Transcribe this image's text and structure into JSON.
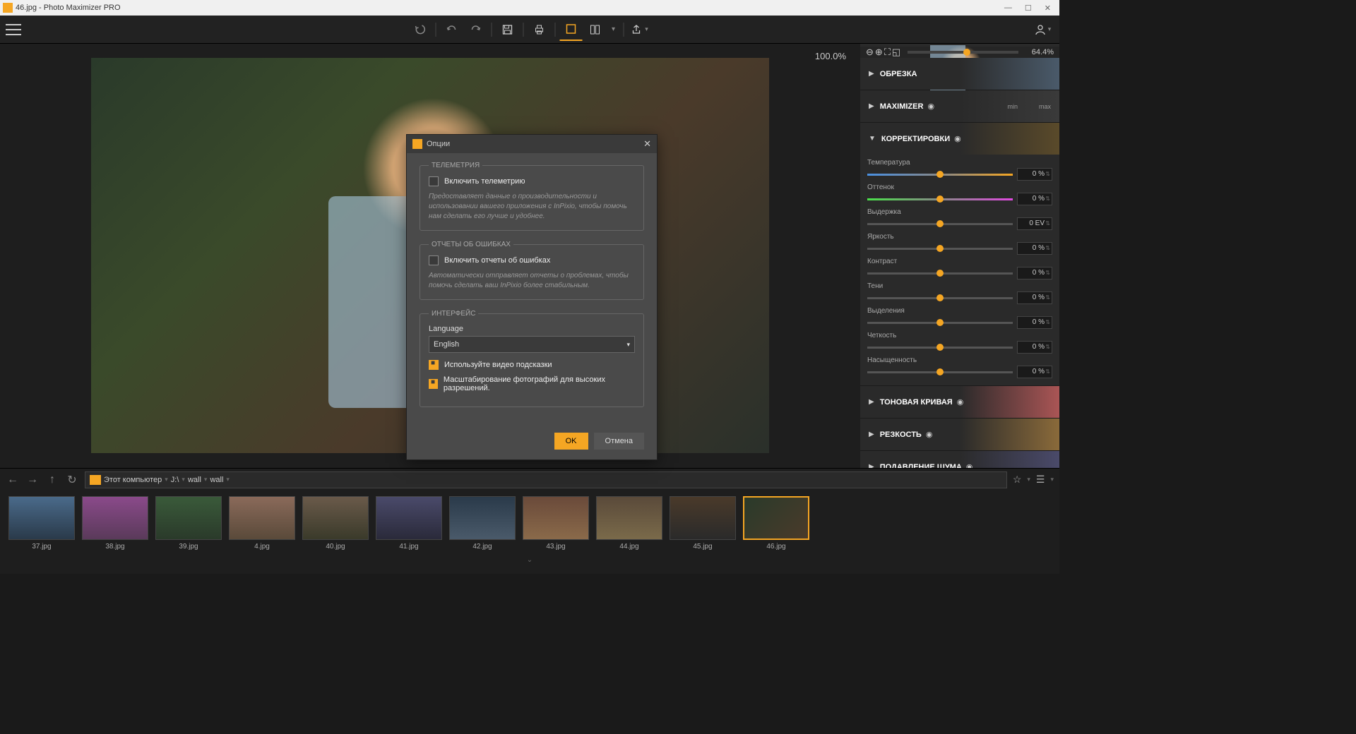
{
  "title": "46.jpg - Photo Maximizer PRO",
  "zoom_label": "100.0%",
  "preview_zoom": "64.4%",
  "panels": {
    "crop": "ОБРЕЗКА",
    "maximizer": "MAXIMIZER",
    "adjustments": "КОРРЕКТИРОВКИ",
    "tone": "ТОНОВАЯ КРИВАЯ",
    "sharp": "РЕЗКОСТЬ",
    "noise": "ПОДАВЛЕНИЕ ШУМА"
  },
  "maximizer_min": "min",
  "maximizer_max": "max",
  "adjustments": [
    {
      "label": "Температура",
      "value": "0 %"
    },
    {
      "label": "Оттенок",
      "value": "0 %"
    },
    {
      "label": "Выдержка",
      "value": "0 EV"
    },
    {
      "label": "Яркость",
      "value": "0 %"
    },
    {
      "label": "Контраст",
      "value": "0 %"
    },
    {
      "label": "Тени",
      "value": "0 %"
    },
    {
      "label": "Выделения",
      "value": "0 %"
    },
    {
      "label": "Четкость",
      "value": "0 %"
    },
    {
      "label": "Насыщенность",
      "value": "0 %"
    }
  ],
  "path": {
    "root": "Этот компьютер",
    "drive": "J:\\",
    "folder1": "wall",
    "folder2": "wall"
  },
  "thumbs": [
    {
      "name": "37.jpg"
    },
    {
      "name": "38.jpg"
    },
    {
      "name": "39.jpg"
    },
    {
      "name": "4.jpg"
    },
    {
      "name": "40.jpg"
    },
    {
      "name": "41.jpg"
    },
    {
      "name": "42.jpg"
    },
    {
      "name": "43.jpg"
    },
    {
      "name": "44.jpg"
    },
    {
      "name": "45.jpg"
    },
    {
      "name": "46.jpg",
      "selected": true
    }
  ],
  "dialog": {
    "title": "Опции",
    "telemetry_legend": "ТЕЛЕМЕТРИЯ",
    "telemetry_check": "Включить телеметрию",
    "telemetry_help": "Предоставляет данные о производительности и использовании вашего приложения с InPixio, чтобы помочь нам сделать его лучше и удобнее.",
    "errors_legend": "ОТЧЕТЫ ОБ ОШИБКАХ",
    "errors_check": "Включить отчеты об ошибках",
    "errors_help": "Автоматически отправляет отчеты о проблемах, чтобы помочь сделать ваш InPixio более стабильным.",
    "interface_legend": "ИНТЕРФЕЙС",
    "language_label": "Language",
    "language_value": "English",
    "hints_check": "Используйте видео подсказки",
    "scale_check": "Масштабирование фотографий для высоких разрешений.",
    "ok": "OK",
    "cancel": "Отмена"
  }
}
